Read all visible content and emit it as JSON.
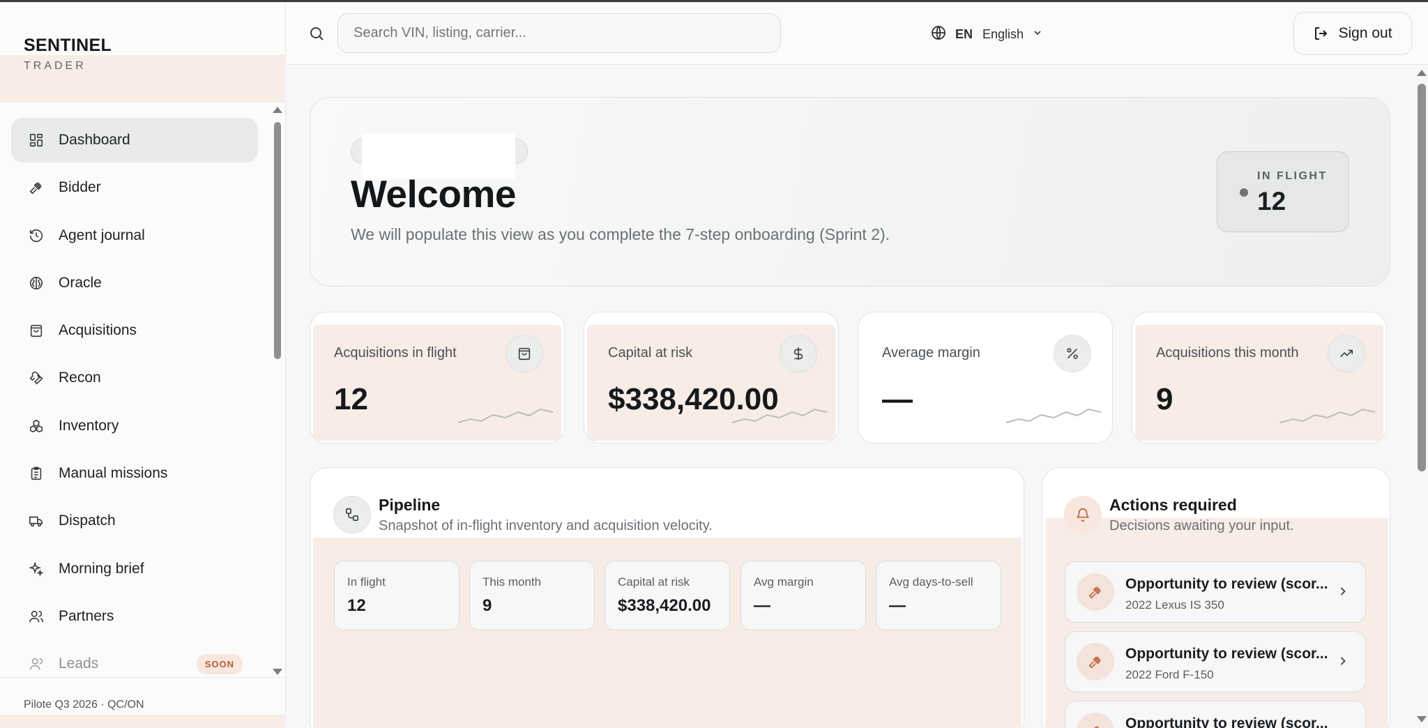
{
  "brand": {
    "name": "SENTINEL",
    "sub": "TRADER"
  },
  "nav": [
    {
      "label": "Dashboard",
      "icon": "dashboard-icon",
      "active": true
    },
    {
      "label": "Bidder",
      "icon": "gavel-icon"
    },
    {
      "label": "Agent journal",
      "icon": "history-icon"
    },
    {
      "label": "Oracle",
      "icon": "brain-icon"
    },
    {
      "label": "Acquisitions",
      "icon": "shopping-bag-icon"
    },
    {
      "label": "Recon",
      "icon": "wrench-icon"
    },
    {
      "label": "Inventory",
      "icon": "boxes-icon"
    },
    {
      "label": "Manual missions",
      "icon": "clipboard-icon"
    },
    {
      "label": "Dispatch",
      "icon": "truck-icon"
    },
    {
      "label": "Morning brief",
      "icon": "sparkles-icon"
    },
    {
      "label": "Partners",
      "icon": "users-icon"
    },
    {
      "label": "Leads",
      "icon": "user-icon",
      "badge": "SOON"
    }
  ],
  "sidebar_footer": "Pilote Q3 2026 · QC/ON",
  "header": {
    "search_placeholder": "Search VIN, listing, carrier...",
    "lang_code": "EN",
    "lang_name": "English",
    "signout_label": "Sign out"
  },
  "hero": {
    "title": "Welcome",
    "subtitle": "We will populate this view as you complete the 7-step onboarding (Sprint 2).",
    "inflight_label": "IN FLIGHT",
    "inflight_value": "12"
  },
  "stats": [
    {
      "label": "Acquisitions in flight",
      "value": "12",
      "icon": "shopping-bag-icon"
    },
    {
      "label": "Capital at risk",
      "value": "$338,420.00",
      "icon": "dollar-icon"
    },
    {
      "label": "Average margin",
      "value": "—",
      "icon": "percent-icon"
    },
    {
      "label": "Acquisitions this month",
      "value": "9",
      "icon": "trending-up-icon"
    }
  ],
  "pipeline": {
    "title": "Pipeline",
    "subtitle": "Snapshot of in-flight inventory and acquisition velocity.",
    "metrics": [
      {
        "label": "In flight",
        "value": "12"
      },
      {
        "label": "This month",
        "value": "9"
      },
      {
        "label": "Capital at risk",
        "value": "$338,420.00"
      },
      {
        "label": "Avg margin",
        "value": "—"
      },
      {
        "label": "Avg days-to-sell",
        "value": "—"
      }
    ]
  },
  "actions": {
    "title": "Actions required",
    "subtitle": "Decisions awaiting your input.",
    "items": [
      {
        "title": "Opportunity to review (scor...",
        "sub": "2022 Lexus IS 350"
      },
      {
        "title": "Opportunity to review (scor...",
        "sub": "2022 Ford F-150"
      },
      {
        "title": "Opportunity to review (scor...",
        "sub": ""
      }
    ]
  },
  "colors": {
    "accent_band": "#f7ece6",
    "badge_text": "#b35a34",
    "active_nav": "#e9ebe9"
  }
}
